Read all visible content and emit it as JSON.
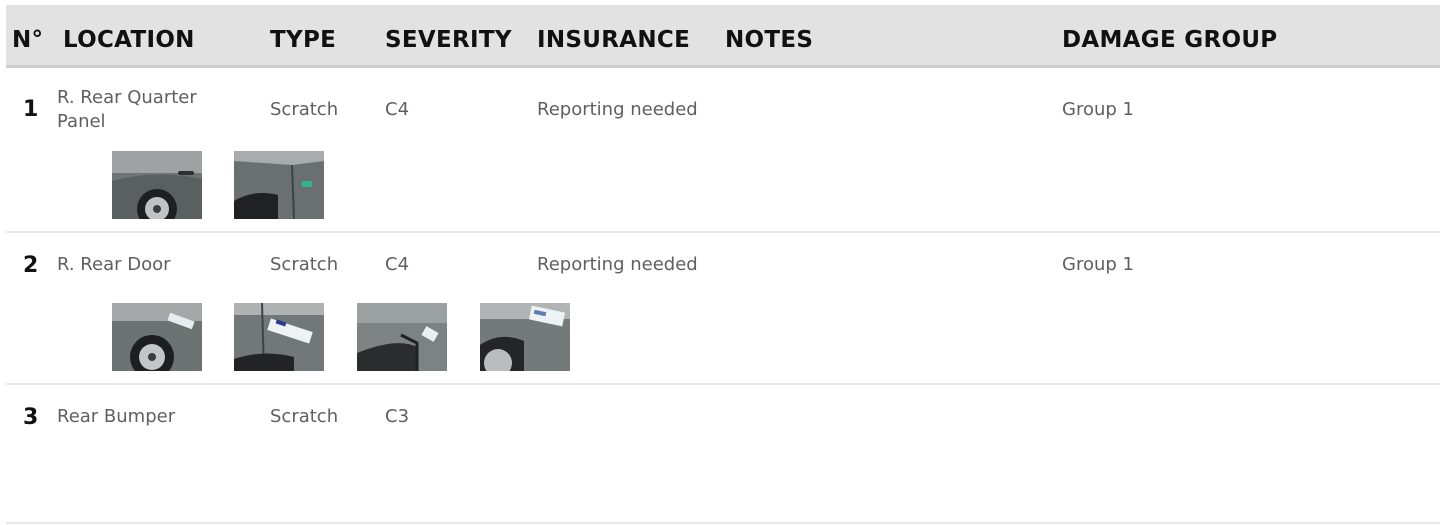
{
  "table": {
    "headers": {
      "number": "N°",
      "location": "LOCATION",
      "type": "TYPE",
      "severity": "SEVERITY",
      "insurance": "INSURANCE",
      "notes": "NOTES",
      "damage_group": "DAMAGE GROUP"
    },
    "rows": [
      {
        "number": "1",
        "location": "R. Rear Quarter Panel",
        "type": "Scratch",
        "severity": "C4",
        "insurance": "Reporting needed",
        "notes": "",
        "damage_group": "Group 1",
        "photo_count": 2
      },
      {
        "number": "2",
        "location": "R. Rear Door",
        "type": "Scratch",
        "severity": "C4",
        "insurance": "Reporting needed",
        "notes": "",
        "damage_group": "Group 1",
        "photo_count": 4
      },
      {
        "number": "3",
        "location": "Rear Bumper",
        "type": "Scratch",
        "severity": "C3",
        "insurance": "",
        "notes": "",
        "damage_group": "",
        "photo_count": 0
      }
    ]
  },
  "colors": {
    "header_bg": "#e2e2e2",
    "header_text": "#111111",
    "cell_text": "#5f5f5f",
    "divider": "#e8e8e8"
  }
}
